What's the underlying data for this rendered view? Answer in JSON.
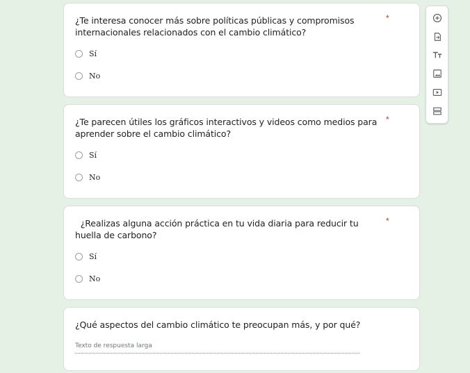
{
  "questions": [
    {
      "title": "¿Te interesa conocer más sobre políticas públicas y compromisos internacionales relacionados con el cambio climático?",
      "required_mark": "*",
      "options": [
        "Sí",
        "No"
      ]
    },
    {
      "title": "¿Te parecen útiles los gráficos interactivos y videos como medios para aprender sobre el cambio climático?",
      "required_mark": "*",
      "options": [
        "Sí",
        "No"
      ]
    },
    {
      "title": "  ¿Realizas alguna acción práctica en tu vida diaria para reducir tu huella de carbono?",
      "required_mark": "*",
      "options": [
        "Sí",
        "No"
      ]
    },
    {
      "title": "¿Qué aspectos del cambio climático te preocupan más, y por qué?",
      "placeholder": "Texto de respuesta larga"
    }
  ],
  "toolbar": {
    "icons": [
      "add-question-icon",
      "import-questions-icon",
      "add-title-icon",
      "add-image-icon",
      "add-video-icon",
      "add-section-icon"
    ]
  },
  "colors": {
    "background": "#e5f1e5",
    "required": "#d93025"
  }
}
